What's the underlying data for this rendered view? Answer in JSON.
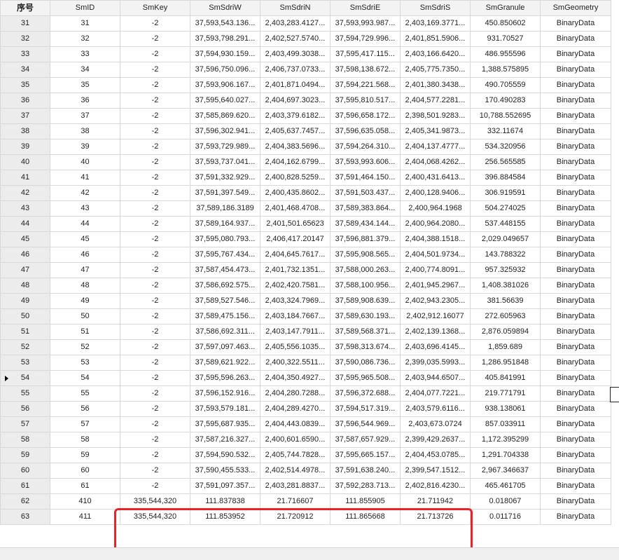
{
  "columns": [
    "序号",
    "SmID",
    "SmKey",
    "SmSdriW",
    "SmSdriN",
    "SmSdriE",
    "SmSdriS",
    "SmGranule",
    "SmGeometry"
  ],
  "current_row_index": 23,
  "rows": [
    [
      "31",
      "31",
      "-2",
      "37,593,543.136...",
      "2,403,283.4127...",
      "37,593,993.987...",
      "2,403,169.3771...",
      "450.850602",
      "BinaryData"
    ],
    [
      "32",
      "32",
      "-2",
      "37,593,798.291...",
      "2,402,527.5740...",
      "37,594,729.996...",
      "2,401,851.5906...",
      "931.70527",
      "BinaryData"
    ],
    [
      "33",
      "33",
      "-2",
      "37,594,930.159...",
      "2,403,499.3038...",
      "37,595,417.115...",
      "2,403,166.6420...",
      "486.955596",
      "BinaryData"
    ],
    [
      "34",
      "34",
      "-2",
      "37,596,750.096...",
      "2,406,737.0733...",
      "37,598,138.672...",
      "2,405,775.7350...",
      "1,388.575895",
      "BinaryData"
    ],
    [
      "35",
      "35",
      "-2",
      "37,593,906.167...",
      "2,401,871.0494...",
      "37,594,221.568...",
      "2,401,380.3438...",
      "490.705559",
      "BinaryData"
    ],
    [
      "36",
      "36",
      "-2",
      "37,595,640.027...",
      "2,404,697.3023...",
      "37,595,810.517...",
      "2,404,577.2281...",
      "170.490283",
      "BinaryData"
    ],
    [
      "37",
      "37",
      "-2",
      "37,585,869.620...",
      "2,403,379.6182...",
      "37,596,658.172...",
      "2,398,501.9283...",
      "10,788.552695",
      "BinaryData"
    ],
    [
      "38",
      "38",
      "-2",
      "37,596,302.941...",
      "2,405,637.7457...",
      "37,596,635.058...",
      "2,405,341.9873...",
      "332.11674",
      "BinaryData"
    ],
    [
      "39",
      "39",
      "-2",
      "37,593,729.989...",
      "2,404,383.5696...",
      "37,594,264.310...",
      "2,404,137.4777...",
      "534.320956",
      "BinaryData"
    ],
    [
      "40",
      "40",
      "-2",
      "37,593,737.041...",
      "2,404,162.6799...",
      "37,593,993.606...",
      "2,404,068.4262...",
      "256.565585",
      "BinaryData"
    ],
    [
      "41",
      "41",
      "-2",
      "37,591,332.929...",
      "2,400,828.5259...",
      "37,591,464.150...",
      "2,400,431.6413...",
      "396.884584",
      "BinaryData"
    ],
    [
      "42",
      "42",
      "-2",
      "37,591,397.549...",
      "2,400,435.8602...",
      "37,591,503.437...",
      "2,400,128.9406...",
      "306.919591",
      "BinaryData"
    ],
    [
      "43",
      "43",
      "-2",
      "37,589,186.3189",
      "2,401,468.4708...",
      "37,589,383.864...",
      "2,400,964.1968",
      "504.274025",
      "BinaryData"
    ],
    [
      "44",
      "44",
      "-2",
      "37,589,164.937...",
      "2,401,501.65623",
      "37,589,434.144...",
      "2,400,964.2080...",
      "537.448155",
      "BinaryData"
    ],
    [
      "45",
      "45",
      "-2",
      "37,595,080.793...",
      "2,406,417.20147",
      "37,596,881.379...",
      "2,404,388.1518...",
      "2,029.049657",
      "BinaryData"
    ],
    [
      "46",
      "46",
      "-2",
      "37,595,767.434...",
      "2,404,645.7617...",
      "37,595,908.565...",
      "2,404,501.9734...",
      "143.788322",
      "BinaryData"
    ],
    [
      "47",
      "47",
      "-2",
      "37,587,454.473...",
      "2,401,732.1351...",
      "37,588,000.263...",
      "2,400,774.8091...",
      "957.325932",
      "BinaryData"
    ],
    [
      "48",
      "48",
      "-2",
      "37,586,692.575...",
      "2,402,420.7581...",
      "37,588,100.956...",
      "2,401,945.2967...",
      "1,408.381026",
      "BinaryData"
    ],
    [
      "49",
      "49",
      "-2",
      "37,589,527.546...",
      "2,403,324.7969...",
      "37,589,908.639...",
      "2,402,943.2305...",
      "381.56639",
      "BinaryData"
    ],
    [
      "50",
      "50",
      "-2",
      "37,589,475.156...",
      "2,403,184.7667...",
      "37,589,630.193...",
      "2,402,912.16077",
      "272.605963",
      "BinaryData"
    ],
    [
      "51",
      "51",
      "-2",
      "37,586,692.311...",
      "2,403,147.7911...",
      "37,589,568.371...",
      "2,402,139.1368...",
      "2,876.059894",
      "BinaryData"
    ],
    [
      "52",
      "52",
      "-2",
      "37,597,097.463...",
      "2,405,556.1035...",
      "37,598,313.674...",
      "2,403,696.4145...",
      "1,859.689",
      "BinaryData"
    ],
    [
      "53",
      "53",
      "-2",
      "37,589,621.922...",
      "2,400,322.5511...",
      "37,590,086.736...",
      "2,399,035.5993...",
      "1,286.951848",
      "BinaryData"
    ],
    [
      "54",
      "54",
      "-2",
      "37,595,596.263...",
      "2,404,350.4927...",
      "37,595,965.508...",
      "2,403,944.6507...",
      "405.841991",
      "BinaryData"
    ],
    [
      "55",
      "55",
      "-2",
      "37,596,152.916...",
      "2,404,280.7288...",
      "37,596,372.688...",
      "2,404,077.7221...",
      "219.771791",
      "BinaryData"
    ],
    [
      "56",
      "56",
      "-2",
      "37,593,579.181...",
      "2,404,289.4270...",
      "37,594,517.319...",
      "2,403,579.6116...",
      "938.138061",
      "BinaryData"
    ],
    [
      "57",
      "57",
      "-2",
      "37,595,687.935...",
      "2,404,443.0839...",
      "37,596,544.969...",
      "2,403,673.0724",
      "857.033911",
      "BinaryData"
    ],
    [
      "58",
      "58",
      "-2",
      "37,587,216.327...",
      "2,400,601.6590...",
      "37,587,657.929...",
      "2,399,429.2637...",
      "1,172.395299",
      "BinaryData"
    ],
    [
      "59",
      "59",
      "-2",
      "37,594,590.532...",
      "2,405,744.7828...",
      "37,595,665.157...",
      "2,404,453.0785...",
      "1,291.704338",
      "BinaryData"
    ],
    [
      "60",
      "60",
      "-2",
      "37,590,455.533...",
      "2,402,514.4978...",
      "37,591,638.240...",
      "2,399,547.1512...",
      "2,967.346637",
      "BinaryData"
    ],
    [
      "61",
      "61",
      "-2",
      "37,591,097.357...",
      "2,403,281.8837...",
      "37,592,283.713...",
      "2,402,816.4230...",
      "465.461705",
      "BinaryData"
    ],
    [
      "62",
      "410",
      "335,544,320",
      "111.837838",
      "21.716607",
      "111.855905",
      "21.711942",
      "0.018067",
      "BinaryData"
    ],
    [
      "63",
      "411",
      "335,544,320",
      "111.853952",
      "21.720912",
      "111.865668",
      "21.713726",
      "0.011716",
      "BinaryData"
    ]
  ]
}
